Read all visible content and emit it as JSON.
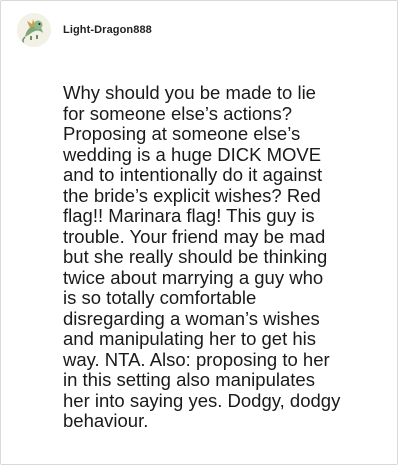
{
  "post": {
    "author": {
      "username": "Light-Dragon888",
      "avatar_icon": "dragon-avatar-icon"
    },
    "comment_text": "Why should you be made to lie\nfor someone else’s actions?\nProposing at someone else’s\nwedding is a huge DICK MOVE\nand to intentionally do it against\nthe bride’s explicit wishes? Red\nflag!! Marinara flag! This guy is\ntrouble. Your friend may be mad\nbut she really should be thinking\ntwice about marrying a guy who\nis so totally comfortable\ndisregarding a woman’s wishes\nand manipulating her to get his\nway. NTA. Also: proposing to her\nin this setting also manipulates\nher into saying yes. Dodgy, dodgy\nbehaviour."
  },
  "colors": {
    "text": "#1a1a1a",
    "border": "#d9d9d9",
    "background": "#ffffff"
  }
}
